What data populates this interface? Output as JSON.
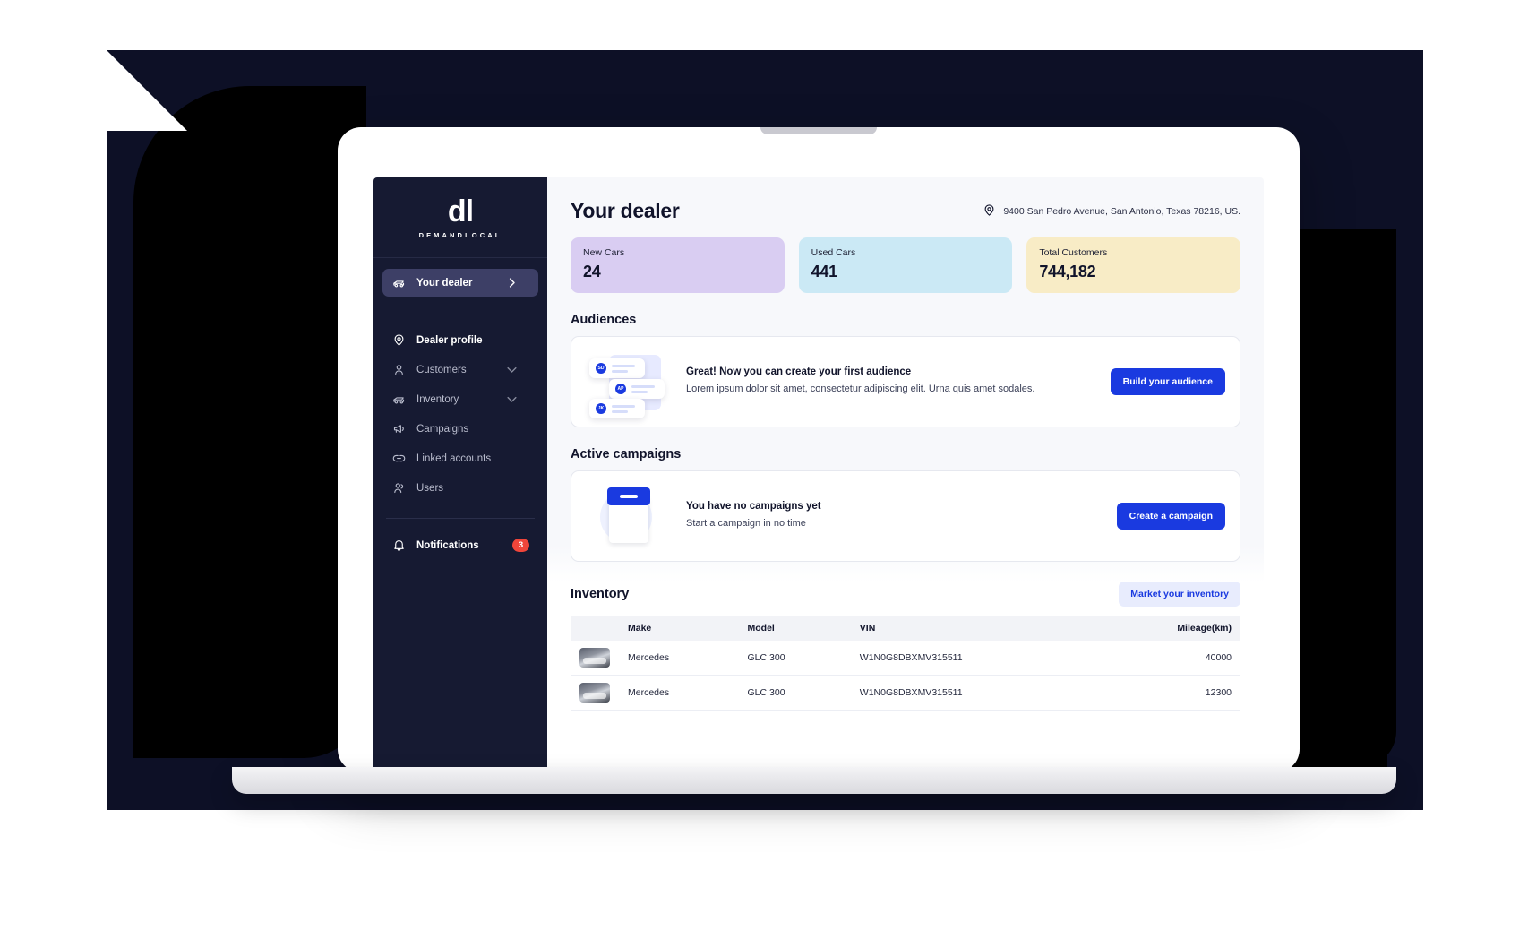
{
  "sidebar": {
    "brand_mark": "dl",
    "brand_word": "DEMANDLOCAL",
    "primary": [
      {
        "label": "Your dealer",
        "icon": "car-icon",
        "active": true,
        "trailing": "chevron-right-icon"
      }
    ],
    "secondary": [
      {
        "label": "Dealer profile",
        "icon": "location-pin-icon",
        "strong": true,
        "trailing": ""
      },
      {
        "label": "Customers",
        "icon": "user-icon",
        "strong": false,
        "trailing": "chevron-down-icon"
      },
      {
        "label": "Inventory",
        "icon": "car-icon",
        "strong": false,
        "trailing": "chevron-down-icon"
      },
      {
        "label": "Campaigns",
        "icon": "megaphone-icon",
        "strong": false,
        "trailing": ""
      },
      {
        "label": "Linked accounts",
        "icon": "link-icon",
        "strong": false,
        "trailing": ""
      },
      {
        "label": "Users",
        "icon": "users-icon",
        "strong": false,
        "trailing": ""
      }
    ],
    "bottom": [
      {
        "label": "Notifications",
        "icon": "bell-icon",
        "badge": "3"
      }
    ]
  },
  "header": {
    "title": "Your dealer",
    "address": "9400 San Pedro Avenue, San Antonio, Texas 78216, US.",
    "address_icon": "location-pin-icon"
  },
  "stats": [
    {
      "label": "New Cars",
      "value": "24",
      "color": "#d9cdf2"
    },
    {
      "label": "Used Cars",
      "value": "441",
      "color": "#cbe9f5"
    },
    {
      "label": "Total Customers",
      "value": "744,182",
      "color": "#f8ecc6"
    }
  ],
  "audiences": {
    "section_title": "Audiences",
    "title": "Great! Now you can create your first audience",
    "description": "Lorem ipsum dolor sit amet, consectetur adipiscing elit. Urna quis amet sodales.",
    "button": "Build your audience",
    "illustration_initials": [
      "SD",
      "AP",
      "JK"
    ]
  },
  "campaigns": {
    "section_title": "Active campaigns",
    "title": "You have no campaigns yet",
    "description": "Start a campaign in no time",
    "button": "Create a campaign"
  },
  "inventory": {
    "section_title": "Inventory",
    "button": "Market your inventory",
    "columns": [
      "",
      "Make",
      "Model",
      "VIN",
      "Mileage(km)"
    ],
    "rows": [
      {
        "thumb": "car-photo",
        "make": "Mercedes",
        "model": "GLC 300",
        "vin": "W1N0G8DBXMV315511",
        "mileage": "40000"
      },
      {
        "thumb": "car-photo",
        "make": "Mercedes",
        "model": "GLC 300",
        "vin": "W1N0G8DBXMV315511",
        "mileage": "12300"
      }
    ]
  },
  "colors": {
    "accent": "#1a3ae0",
    "sidebar_bg": "#161a32",
    "sidebar_active": "#3d3f66",
    "badge": "#f0453a",
    "artboard": "#0d1026"
  }
}
